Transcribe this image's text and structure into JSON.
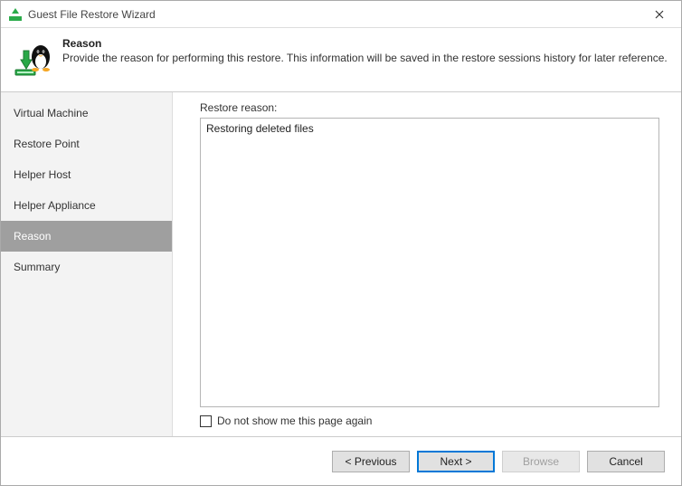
{
  "titlebar": {
    "title": "Guest File Restore Wizard"
  },
  "header": {
    "title": "Reason",
    "description": "Provide the reason for performing this restore. This information will be saved in the restore sessions history for later reference."
  },
  "sidebar": {
    "items": [
      {
        "label": "Virtual Machine",
        "selected": false
      },
      {
        "label": "Restore Point",
        "selected": false
      },
      {
        "label": "Helper Host",
        "selected": false
      },
      {
        "label": "Helper Appliance",
        "selected": false
      },
      {
        "label": "Reason",
        "selected": true
      },
      {
        "label": "Summary",
        "selected": false
      }
    ]
  },
  "content": {
    "fieldLabel": "Restore reason:",
    "reasonText": "Restoring deleted files",
    "checkboxLabel": "Do not show me this page again"
  },
  "footer": {
    "previous": "< Previous",
    "next": "Next >",
    "browse": "Browse",
    "cancel": "Cancel"
  }
}
